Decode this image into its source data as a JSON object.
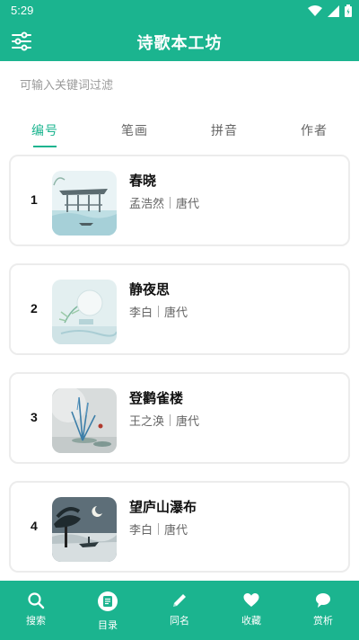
{
  "status_bar": {
    "time": "5:29"
  },
  "app_bar": {
    "title": "诗歌本工坊",
    "filter_icon": "sliders-icon"
  },
  "search": {
    "placeholder": "可输入关键词过滤",
    "value": ""
  },
  "tabs": [
    {
      "label": "编号",
      "active": true
    },
    {
      "label": "笔画",
      "active": false
    },
    {
      "label": "拼音",
      "active": false
    },
    {
      "label": "作者",
      "active": false
    }
  ],
  "poems": [
    {
      "number": "1",
      "title": "春晓",
      "author": "孟浩然",
      "dynasty": "唐代"
    },
    {
      "number": "2",
      "title": "静夜思",
      "author": "李白",
      "dynasty": "唐代"
    },
    {
      "number": "3",
      "title": "登鹳雀楼",
      "author": "王之涣",
      "dynasty": "唐代"
    },
    {
      "number": "4",
      "title": "望庐山瀑布",
      "author": "李白",
      "dynasty": "唐代"
    }
  ],
  "bottom_nav": [
    {
      "label": "搜索",
      "icon": "search-icon",
      "active": false
    },
    {
      "label": "目录",
      "icon": "book-icon",
      "active": true
    },
    {
      "label": "同名",
      "icon": "pencil-icon",
      "active": false
    },
    {
      "label": "收藏",
      "icon": "heart-icon",
      "active": false
    },
    {
      "label": "赏析",
      "icon": "chat-bubble-icon",
      "active": false
    }
  ],
  "colors": {
    "primary": "#1bb48f",
    "card_border": "#ececec",
    "text_muted": "#666666"
  }
}
